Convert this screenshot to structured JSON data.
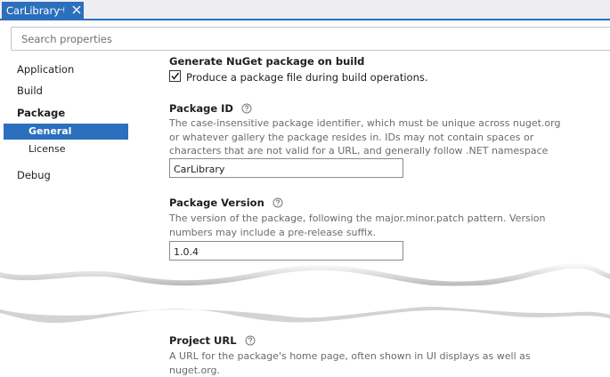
{
  "tab": {
    "title": "CarLibrary",
    "pin_glyph": "⊣"
  },
  "search": {
    "placeholder": "Search properties",
    "value": ""
  },
  "sidebar": {
    "application": "Application",
    "build": "Build",
    "package": "Package",
    "general": "General",
    "license": "License",
    "debug": "Debug"
  },
  "content": {
    "generate": {
      "heading": "Generate NuGet package on build",
      "checkbox_label": "Produce a package file during build operations.",
      "checked": true
    },
    "package_id": {
      "heading": "Package ID",
      "description": "The case-insensitive package identifier, which must be unique across nuget.org or whatever gallery the package resides in. IDs may not contain spaces or characters that are not valid for a URL, and generally follow .NET namespace rules.",
      "value": "CarLibrary"
    },
    "package_version": {
      "heading": "Package Version",
      "description": "The version of the package, following the major.minor.patch pattern. Version numbers may include a pre-release suffix.",
      "value": "1.0.4"
    },
    "project_url": {
      "heading": "Project URL",
      "description": "A URL for the package's home page, often shown in UI displays as well as nuget.org."
    }
  },
  "colors": {
    "accent": "#2c6fbd",
    "description_text": "#6b6b6b",
    "tab_strip": "#eeeef2"
  },
  "icons": {
    "help": "question-circle-icon",
    "close": "close-icon",
    "pin": "pin-icon",
    "check": "checkmark-icon"
  }
}
